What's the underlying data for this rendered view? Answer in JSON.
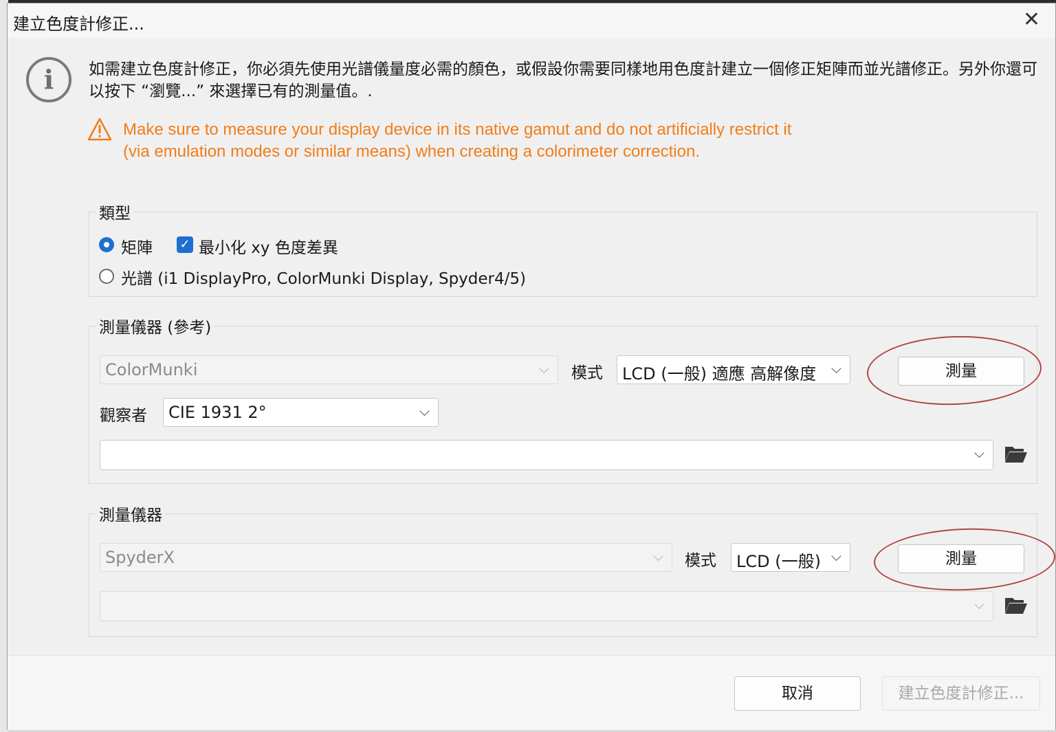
{
  "dialog": {
    "title": "建立色度計修正...",
    "close_glyph": "✕",
    "info_text": "如需建立色度計修正，你必須先使用光譜儀量度必需的顏色，或假設你需要同樣地用色度計建立一個修正矩陣而並光譜修正。另外你還可以按下 “瀏覽...” 來選擇已有的測量值。.",
    "warning_text": "Make sure to measure your display device in its native gamut and do not artificially restrict it (via emulation modes or similar means) when creating a colorimeter correction."
  },
  "type_group": {
    "legend": "類型",
    "matrix_label": "矩陣",
    "matrix_selected": true,
    "minimize_label": "最小化 xy 色度差異",
    "minimize_checked": true,
    "spectral_label": "光譜 (i1 DisplayPro, ColorMunki Display, Spyder4/5)",
    "spectral_selected": false
  },
  "reference_group": {
    "legend": "測量儀器 (參考)",
    "instrument": "ColorMunki",
    "mode_label": "模式",
    "mode_value": "LCD (一般) 適應 高解像度",
    "measure_label": "測量",
    "observer_label": "觀察者",
    "observer_value": "CIE 1931 2°",
    "file_value": ""
  },
  "instrument_group": {
    "legend": "測量儀器",
    "instrument": "SpyderX",
    "mode_label": "模式",
    "mode_value": "LCD (一般)",
    "measure_label": "測量",
    "file_value": ""
  },
  "footer": {
    "cancel_label": "取消",
    "create_label": "建立色度計修正..."
  },
  "icons": {
    "info": "info-icon",
    "warning": "warning-icon",
    "folder": "folder-open-icon",
    "chevron": "chevron-down-icon"
  },
  "colors": {
    "accent": "#1e6fd1",
    "warning": "#f07d1a",
    "annotation": "#b0473e"
  }
}
